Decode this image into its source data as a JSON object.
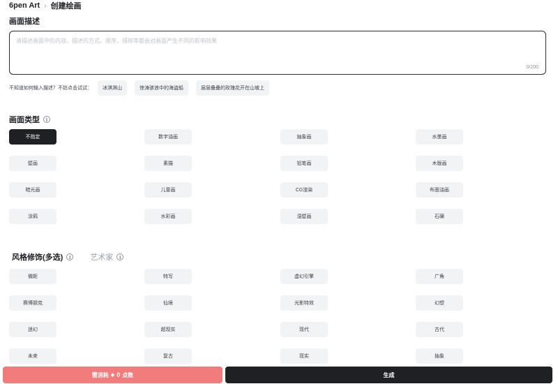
{
  "breadcrumb": {
    "brand": "6pen Art",
    "separator": "›",
    "current": "创建绘画"
  },
  "description": {
    "title": "画面描述",
    "placeholder": "请描述画面中的内容，描述的方式，顺序，措辞等都会对画面产生不同的影响效果",
    "value": "",
    "counter": "0/200"
  },
  "hints": {
    "label": "不知道如何输入描述？不妨点击试试：",
    "items": [
      "冰淇淋山",
      "惊涛骇浪中的海盗船",
      "层层叠叠的玫瑰花开在山坡上"
    ]
  },
  "painting_type": {
    "title": "画面类型",
    "info_icon": "ⓘ",
    "selected": "不指定",
    "items": [
      "不指定",
      "数字油画",
      "抽象画",
      "水墨画",
      "壁画",
      "素描",
      "铅笔画",
      "木版画",
      "暗光画",
      "儿童画",
      "CG渲染",
      "布面油画",
      "涂鸦",
      "水彩画",
      "湿壁画",
      "石磺"
    ]
  },
  "style_tabs": {
    "active": "风格修饰(多选)",
    "inactive": "艺术家",
    "info_icon": "ⓘ"
  },
  "style_modifiers": {
    "items": [
      "微距",
      "特写",
      "虚幻引擎",
      "广角",
      "赛博朋克",
      "仙境",
      "光影特效",
      "幻想",
      "迷幻",
      "超现实",
      "现代",
      "古代",
      "未来",
      "复古",
      "现实",
      "抽象"
    ]
  },
  "footer": {
    "cost_prefix": "需消耗",
    "cost_icon": "◈",
    "cost_value": "0",
    "cost_unit": "点数",
    "generate_label": "生成"
  },
  "colors": {
    "dark": "#1f2023",
    "chip_bg": "#f2f3f5",
    "cost_button": "#f27b7b"
  }
}
